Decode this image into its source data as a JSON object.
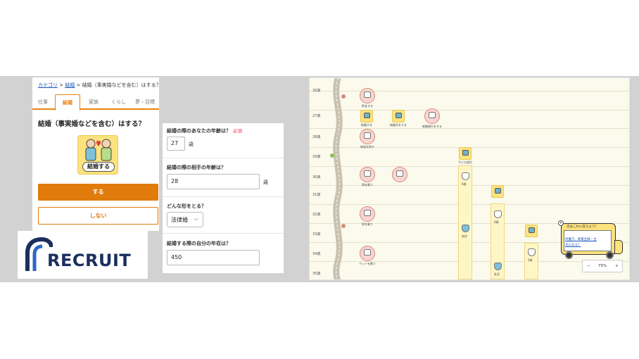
{
  "panelA": {
    "breadcrumb": {
      "category": "カテゴリ",
      "sep1": ">",
      "marriage": "結婚",
      "sep2": ">",
      "current": "結婚（事実婚などを含む）はする？"
    },
    "tabs": [
      "仕事",
      "結婚",
      "家族",
      "くらし",
      "夢・目標"
    ],
    "active_tab": "結婚",
    "question": "結婚（事実婚などを含む）はする？",
    "icon_label": "結婚する",
    "yes_label": "する",
    "no_label": "しない",
    "accent_color": "#e07b0c"
  },
  "logo": {
    "wordmark": "RECRUIT",
    "brand_color": "#1b2f5e"
  },
  "panelB": {
    "q1": {
      "label": "結婚の際のあなたの年齢は？",
      "required": "必須",
      "value": "27",
      "unit": "歳"
    },
    "q2": {
      "label": "結婚の際の相手の年齢は？",
      "value": "28",
      "unit": "歳"
    },
    "q3": {
      "label": "どんな形をとる？",
      "value": "法律婚",
      "caret": "⌵"
    },
    "q4": {
      "label": "結婚する際の自分の年収は？",
      "value": "450"
    }
  },
  "panelC": {
    "ages": [
      "26歳",
      "27歳",
      "28歳",
      "29歳",
      "30歳",
      "31歳",
      "32歳",
      "33歳",
      "34歳",
      "35歳"
    ],
    "events": [
      "貯金する",
      "結婚する",
      "結婚式をする",
      "新婚旅行をする",
      "新居を探す",
      "子ども誕生",
      "車を買う",
      "家を買う",
      "ペットを飼う"
    ],
    "columns": [
      "0歳",
      "幼児",
      "乳児"
    ],
    "bus": {
      "heading": "次はこれに答えよう！",
      "link1": "共働き、専業主婦・主",
      "link2": "夫になる？"
    },
    "zoom": {
      "minus": "−",
      "value": "75%",
      "plus": "+"
    }
  }
}
